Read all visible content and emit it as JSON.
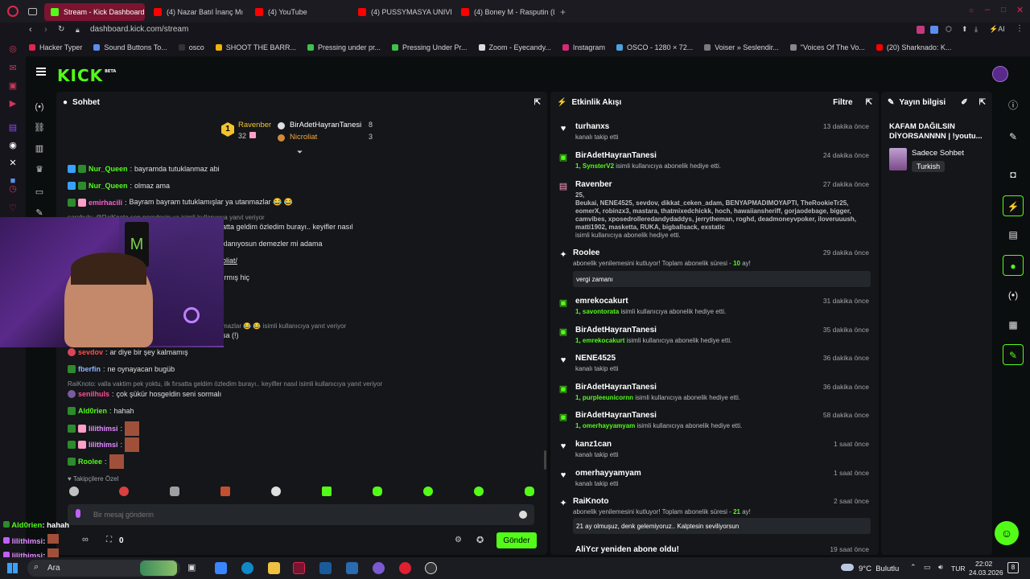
{
  "browser": {
    "tabs": [
      {
        "label": "Stream - Kick Dashboard",
        "active": true
      },
      {
        "label": "(4) Nazar Batıl İnanç Mı Y..."
      },
      {
        "label": "(4) YouTube"
      },
      {
        "label": "(4) PUSSYMASYA UNIVER..."
      },
      {
        "label": "(4) Boney M - Rasputin (Ly..."
      }
    ],
    "url": "dashboard.kick.com/stream",
    "bookmarks": [
      "Hacker Typer",
      "Sound Buttons To...",
      "osco",
      "SHOOT THE BARR...",
      "Pressing under pr...",
      "Pressing Under Pr...",
      "Zoom - Eyecandy...",
      "Instagram",
      "OSCO - 1280 × 72...",
      "Voiser » Seslendir...",
      "\"Voices Of The Vo...",
      "(20) Sharknado: K..."
    ]
  },
  "kick": {
    "logo": "KICK",
    "beta": "BETA"
  },
  "chat": {
    "title": "Sohbet",
    "leaderboard": {
      "first": {
        "rank": "1",
        "name": "Ravenber",
        "count": "32"
      },
      "second": {
        "name": "BirAdetHayranTanesi",
        "count": "8"
      },
      "third": {
        "name": "Nicroliat",
        "count": "3"
      }
    },
    "messages": [
      {
        "user": "Nur_Queen",
        "text": "bayramda tutuklanmaz abi",
        "color": "#53fc18"
      },
      {
        "user": "Nur_Queen",
        "text": "olmaz ama",
        "color": "#53fc18"
      },
      {
        "user": "emirhacili",
        "text": "Bayram bayram tutuklamışlar ya utanmazlar 😂 😂",
        "color": "#ff5cd1"
      },
      {
        "reply": "sarahuls: @RaiKnoto sen neredesin ya isimli kullanıcıya yanıt veriyor"
      },
      {
        "text": "atta geldim özledim burayı.. keyifler nasıl"
      },
      {
        "text": "klanıyosun demezler mi adama"
      },
      {
        "text": "oliat/"
      },
      {
        "text": "ırmış hiç"
      },
      {
        "reply": "mazlar 😂 😂 isimli kullanıcıya yanıt veriyor"
      },
      {
        "text": "sa (!)"
      },
      {
        "user": "sevdov",
        "text": "ar diye bir şey kalmamış",
        "color": "#ff4d4d"
      },
      {
        "user": "fberfin",
        "text": "ne oynayacan bugüb",
        "color": "#8fb4ff"
      },
      {
        "reply": "RaiKnoto: valla vaktim pek yoktu, ilk fırsatta geldim özledim burayı.. keyifler nasıl isimli kullanıcıya yanıt veriyor"
      },
      {
        "user": "senilhuls",
        "text": "çok şükür hosgeldin seni sormalı",
        "color": "#ff4d9a"
      },
      {
        "user": "Ald0rien",
        "text": "hahah",
        "color": "#53fc18"
      },
      {
        "user": "lilithimsi",
        "text": "",
        "color": "#e28bff"
      },
      {
        "user": "lilithimsi",
        "text": "",
        "color": "#e28bff"
      },
      {
        "user": "Roolee",
        "text": "",
        "color": "#53fc18"
      }
    ],
    "emote_label": "Takipçilere Özel",
    "input_placeholder": "Bir mesaj gönderin",
    "counter": "0",
    "send_label": "Gönder",
    "overlay": [
      {
        "user": "Ald0rien",
        "text": ": hahah"
      },
      {
        "user": "lilithimsi",
        "text": ":"
      },
      {
        "user": "lilithimsi",
        "text": ":"
      }
    ]
  },
  "activity": {
    "title": "Etkinlik Akışı",
    "filter": "Filtre",
    "items": [
      {
        "user": "turhanxs",
        "time": "13 dakika önce",
        "sub": "kanalı takip etti"
      },
      {
        "user": "BirAdetHayranTanesi",
        "time": "24 dakika önce",
        "sub_pre": "1, SynsterV2",
        "sub": " isimli kullanıcıya abonelik hediye etti."
      },
      {
        "user": "Ravenber",
        "time": "27 dakika önce",
        "count": "25,",
        "names1": "Beukai, NENE4525, sevdov, dikkat_ceken_adam, BENYAPMADIMOYAPTI, TheRookieTr25,",
        "names2": "eomerX, robinzx3, mastara, thatmixedchickk, hoch, hawaiiansheriff, gorjaodebage, bigger,",
        "names3": "camvibes, xposedrolleredandydaddys, jerrytheman, roghd, deadmoneyvpoker, iloveruuush,",
        "names4": "matti1902, masketta, RUKA, bigballsack, exstatic",
        "sub": "isimli kullanıcıya abonelik hediye etti."
      },
      {
        "user": "Roolee",
        "time": "29 dakika önce",
        "sub_pre": "abonelik yenilemesini kutluyor! Toplam abonelik süresi - ",
        "sub_num": "10",
        "sub": " ay!",
        "box": "vergi zamanı"
      },
      {
        "user": "emrekocakurt",
        "time": "31 dakika önce",
        "sub_pre": "1, savontorata",
        "sub": " isimli kullanıcıya abonelik hediye etti."
      },
      {
        "user": "BirAdetHayranTanesi",
        "time": "35 dakika önce",
        "sub_pre": "1, emrekocakurt",
        "sub": " isimli kullanıcıya abonelik hediye etti."
      },
      {
        "user": "NENE4525",
        "time": "36 dakika önce",
        "sub": "kanalı takip etti"
      },
      {
        "user": "BirAdetHayranTanesi",
        "time": "36 dakika önce",
        "sub_pre": "1, purpleeunicornn",
        "sub": " isimli kullanıcıya abonelik hediye etti."
      },
      {
        "user": "BirAdetHayranTanesi",
        "time": "58 dakika önce",
        "sub_pre": "1, omerhayyamyam",
        "sub": " isimli kullanıcıya abonelik hediye etti."
      },
      {
        "user": "kanz1can",
        "time": "1 saat önce",
        "sub": "kanalı takip etti"
      },
      {
        "user": "omerhayyamyam",
        "time": "1 saat önce",
        "sub": "kanalı takip etti"
      },
      {
        "user": "RaiKnoto",
        "time": "2 saat önce",
        "sub_pre": "abonelik yenilemesini kutluyor! Toplam abonelik süresi - ",
        "sub_num": "21",
        "sub": " ay!",
        "box": "21 ay olmuşuz, denk gelemiyoruz.. Kalptesin seviliyorsun"
      },
      {
        "user": "AliYcr yeniden abone oldu!",
        "time": "19 saat önce"
      }
    ]
  },
  "info": {
    "title": "Yayın bilgisi",
    "stream_title": "KAFAM DAĞILSIN DİYORSANNNN | !youtu...",
    "category": "Sadece Sohbet",
    "language": "Turkish"
  },
  "taskbar": {
    "search": "Ara",
    "weather": "9°C  Bulutlu",
    "lang": "TUR",
    "time": "22:02",
    "date": "24.03.2026",
    "notif": "8"
  },
  "colors": {
    "accent": "#53fc18",
    "bg": "#0b0e0f",
    "panel": "#141619",
    "opera": "#d1355b"
  }
}
